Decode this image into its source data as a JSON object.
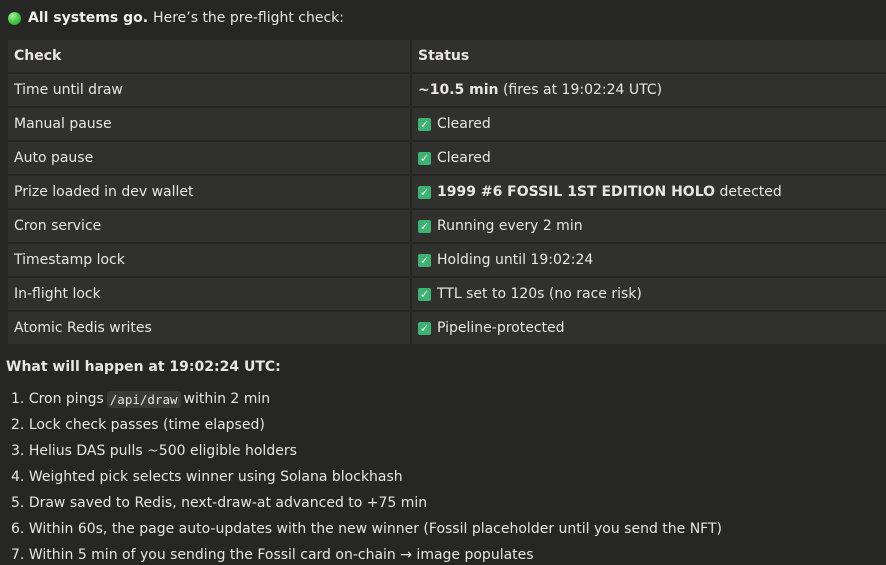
{
  "intro": {
    "bold": "All systems go.",
    "rest": "Here’s the pre-flight check:"
  },
  "table": {
    "headers": [
      "Check",
      "Status"
    ],
    "rows": [
      {
        "check": "Time until draw",
        "status_bold": "~10.5 min",
        "status_text": " (fires at 19:02:24 UTC)",
        "icon": ""
      },
      {
        "check": "Manual pause",
        "status_bold": "",
        "status_text": "Cleared",
        "icon": "check-box-icon"
      },
      {
        "check": "Auto pause",
        "status_bold": "",
        "status_text": "Cleared",
        "icon": "check-box-icon"
      },
      {
        "check": "Prize loaded in dev wallet",
        "status_bold": "1999 #6 FOSSIL 1ST EDITION HOLO",
        "status_text": " detected",
        "icon": "check-box-icon"
      },
      {
        "check": "Cron service",
        "status_bold": "",
        "status_text": "Running every 2 min",
        "icon": "check-box-icon"
      },
      {
        "check": "Timestamp lock",
        "status_bold": "",
        "status_text": "Holding until 19:02:24",
        "icon": "check-box-icon"
      },
      {
        "check": "In-flight lock",
        "status_bold": "",
        "status_text": "TTL set to 120s (no race risk)",
        "icon": "check-box-icon"
      },
      {
        "check": "Atomic Redis writes",
        "status_bold": "",
        "status_text": "Pipeline-protected",
        "icon": "check-box-icon"
      }
    ]
  },
  "section_title": "What will happen at 19:02:24 UTC:",
  "steps": [
    {
      "num": "1.",
      "before": "Cron pings",
      "code": "/api/draw",
      "after": "within 2 min"
    },
    {
      "num": "2.",
      "before": "Lock check passes (time elapsed)",
      "code": "",
      "after": ""
    },
    {
      "num": "3.",
      "before": "Helius DAS pulls ~500 eligible holders",
      "code": "",
      "after": ""
    },
    {
      "num": "4.",
      "before": "Weighted pick selects winner using Solana blockhash",
      "code": "",
      "after": ""
    },
    {
      "num": "5.",
      "before": "Draw saved to Redis, next-draw-at advanced to +75 min",
      "code": "",
      "after": ""
    },
    {
      "num": "6.",
      "before": "Within 60s, the page auto-updates with the new winner (Fossil placeholder until you send the NFT)",
      "code": "",
      "after": ""
    },
    {
      "num": "7.",
      "before": "Within 5 min of you sending the Fossil card on-chain → image populates",
      "code": "",
      "after": ""
    }
  ],
  "colors": {
    "background": "#262624",
    "cell": "#30302e",
    "check_green": "#3cb371",
    "status_dot": "#4ccf4c"
  }
}
